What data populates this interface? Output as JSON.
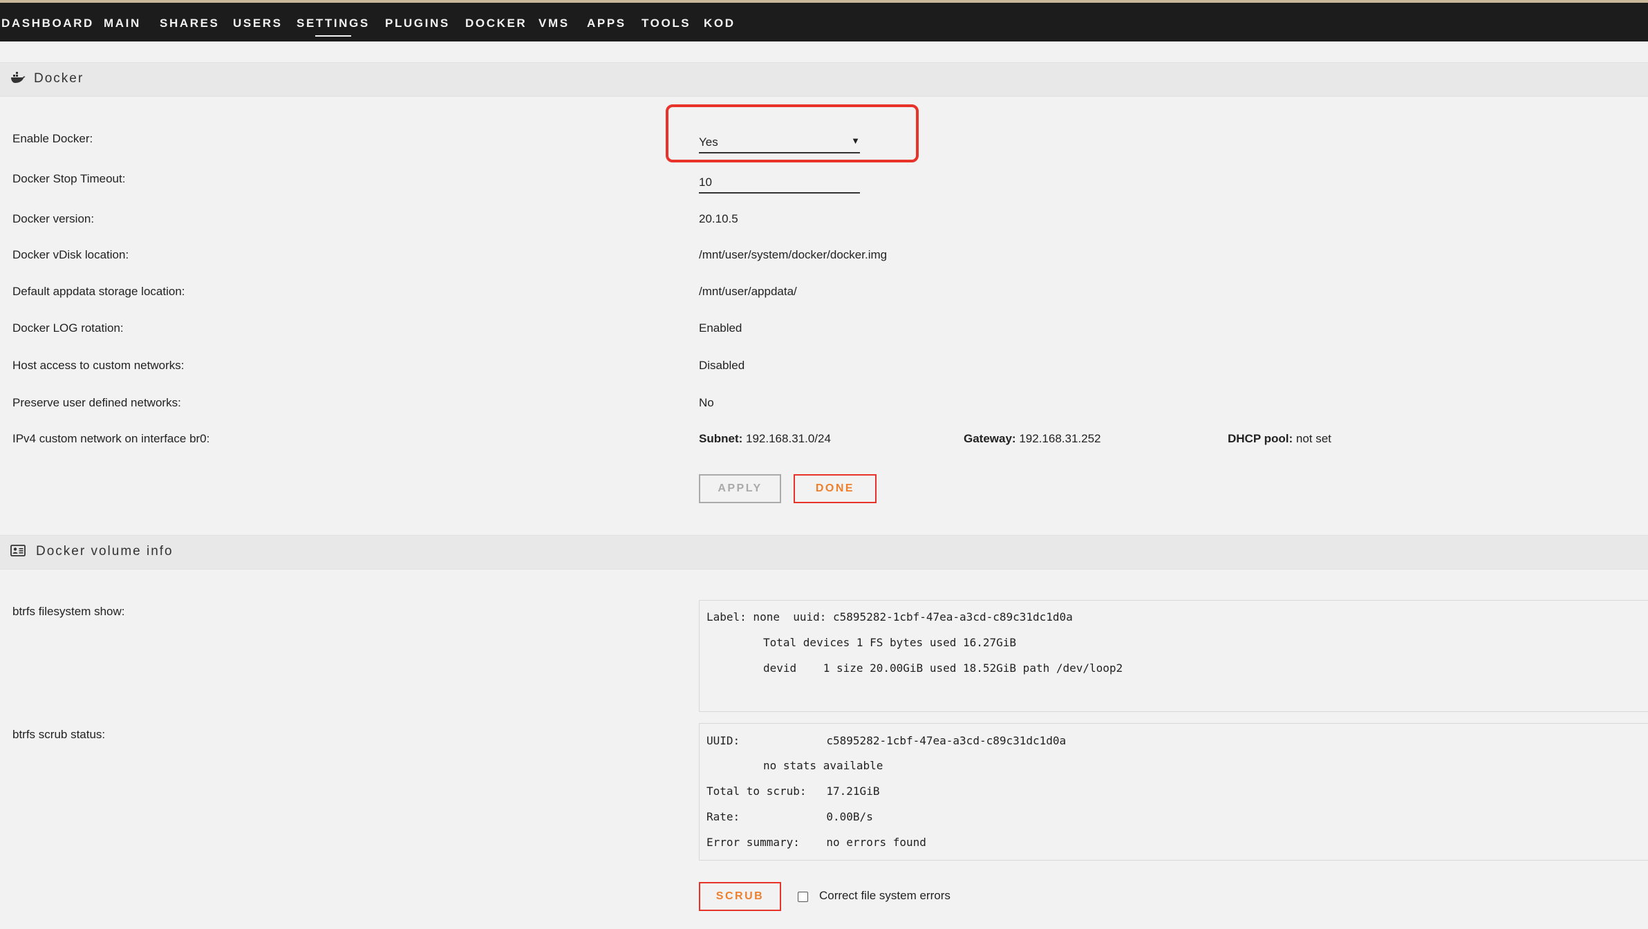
{
  "nav": {
    "items": [
      {
        "label": "DASHBOARD"
      },
      {
        "label": "MAIN"
      },
      {
        "label": "SHARES"
      },
      {
        "label": "USERS"
      },
      {
        "label": "SETTINGS"
      },
      {
        "label": "PLUGINS"
      },
      {
        "label": "DOCKER"
      },
      {
        "label": "VMS"
      },
      {
        "label": "APPS"
      },
      {
        "label": "TOOLS"
      },
      {
        "label": "KOD"
      }
    ],
    "active": "SETTINGS"
  },
  "docker_section": {
    "title": "Docker",
    "icon": "docker-whale-icon",
    "enable_label": "Enable Docker:",
    "enable_value": "Yes",
    "timeout_label": "Docker Stop Timeout:",
    "timeout_value": "10",
    "version_label": "Docker version:",
    "version_value": "20.10.5",
    "vdisk_label": "Docker vDisk location:",
    "vdisk_value": "/mnt/user/system/docker/docker.img",
    "appdata_label": "Default appdata storage location:",
    "appdata_value": "/mnt/user/appdata/",
    "log_label": "Docker LOG rotation:",
    "log_value": "Enabled",
    "host_access_label": "Host access to custom networks:",
    "host_access_value": "Disabled",
    "preserve_label": "Preserve user defined networks:",
    "preserve_value": "No",
    "ipv4_label": "IPv4 custom network on interface br0:",
    "subnet_key": "Subnet:",
    "subnet_value": "192.168.31.0/24",
    "gateway_key": "Gateway:",
    "gateway_value": "192.168.31.252",
    "dhcp_key": "DHCP pool:",
    "dhcp_value": "not set",
    "apply_label": "APPLY",
    "done_label": "DONE"
  },
  "volume_section": {
    "title": "Docker volume info",
    "icon": "id-card-icon",
    "fs_show_label": "btrfs filesystem show:",
    "fs_show_lines": [
      "Label: none  uuid: c5895282-1cbf-47ea-a3cd-c89c31dc1d0a",
      "\tTotal devices 1 FS bytes used 16.27GiB",
      "\tdevid    1 size 20.00GiB used 18.52GiB path /dev/loop2"
    ],
    "scrub_status_label": "btrfs scrub status:",
    "scrub_lines": [
      "UUID:             c5895282-1cbf-47ea-a3cd-c89c31dc1d0a",
      "\tno stats available",
      "Total to scrub:   17.21GiB",
      "Rate:             0.00B/s",
      "Error summary:    no errors found"
    ],
    "scrub_button": "SCRUB",
    "correct_errors_label": "Correct file system errors"
  },
  "colors": {
    "navbar_bg": "#1c1c1c",
    "accent_orange": "#ee7f2d",
    "highlight_red": "#e8332a"
  }
}
